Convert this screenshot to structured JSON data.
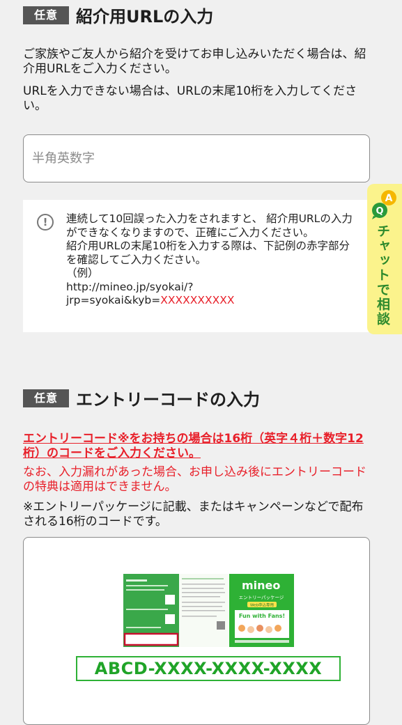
{
  "referral": {
    "badge": "任意",
    "title": "紹介用URLの入力",
    "desc1": "ご家族やご友人から紹介を受けてお申し込みいただく場合は、紹介用URLをご入力ください。",
    "desc2": "URLを入力できない場合は、URLの末尾10桁を入力してください。",
    "input_placeholder": "半角英数字",
    "input_value": "",
    "notice_line1": "連続して10回誤った入力をされますと、 紹介用URLの入力ができなくなりますので、正確にご入力ください。",
    "notice_line2": "紹介用URLの末尾10桁を入力する際は、下記例の赤字部分を確認してご入力ください。",
    "example_label": "（例）",
    "example_url_part1": "http://mineo.jp/syokai/?",
    "example_url_part2": "jrp=syokai&kyb=",
    "example_url_red": "XXXXXXXXXX"
  },
  "entry_code": {
    "badge": "任意",
    "title": "エントリーコードの入力",
    "highlight": "エントリーコード※をお持ちの場合は16桁（英字４桁＋数字12桁）のコードをご入力ください。",
    "warning": "なお、入力漏れがあった場合、お申し込み後にエントリーコードの特典は適用はできません。",
    "note": "※エントリーパッケージに記載、またはキャンペーンなどで配布される16桁のコードです。",
    "package_brand": "mineo",
    "package_label": "エントリーパッケージ",
    "package_sub": "Web申込専用",
    "package_fun": "Fun with Fans!",
    "code_example": "ABCD-XXXX-XXXX-XXXX"
  },
  "chat": {
    "label": "チャットで相談",
    "icon_a": "A",
    "icon_q": "Q"
  },
  "colors": {
    "badge_bg": "#555555",
    "red": "#e8202a",
    "green": "#2eb135",
    "chat_bg": "#fbf38c"
  }
}
